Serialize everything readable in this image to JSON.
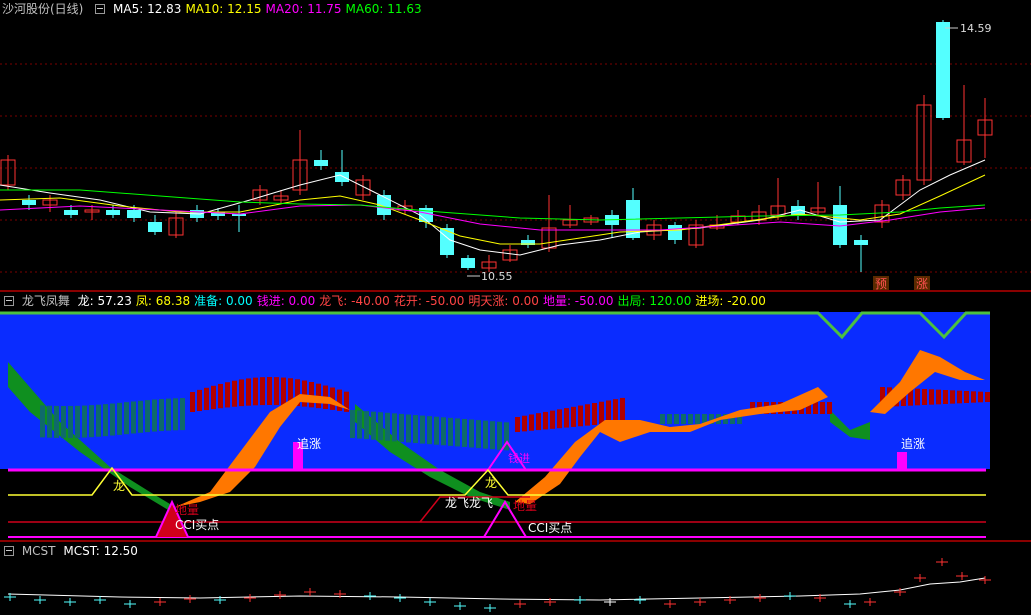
{
  "main": {
    "stock": "沙河股份(日线)",
    "ma": [
      {
        "label": "MA5: ",
        "value": "12.83",
        "color": "#ffffff"
      },
      {
        "label": "MA10: ",
        "value": "12.15",
        "color": "#ffff00"
      },
      {
        "label": "MA20: ",
        "value": "11.75",
        "color": "#ff00ff"
      },
      {
        "label": "MA60: ",
        "value": "11.63",
        "color": "#00ff00"
      }
    ],
    "high_label": "14.59",
    "low_label": "10.55",
    "tag_yu": "预",
    "tag_zhang": "涨",
    "colors": {
      "up": "#ff3232",
      "down": "#54ffff"
    }
  },
  "indicator": {
    "name": "龙飞凤舞",
    "items": [
      {
        "label": "龙: ",
        "value": "57.23",
        "color": "#ffffff"
      },
      {
        "label": "凤: ",
        "value": "68.38",
        "color": "#ffff00"
      },
      {
        "label": "准备: ",
        "value": "0.00",
        "color": "#00ffff"
      },
      {
        "label": "钱进: ",
        "value": "0.00",
        "color": "#ff00ff"
      },
      {
        "label": "龙飞: ",
        "value": "-40.00",
        "color": "#ff4444"
      },
      {
        "label": "花开: ",
        "value": "-50.00",
        "color": "#ff4444"
      },
      {
        "label": "明天涨: ",
        "value": "0.00",
        "color": "#ff4444"
      },
      {
        "label": "地量: ",
        "value": "-50.00",
        "color": "#ff00ff"
      },
      {
        "label": "出局: ",
        "value": "120.00",
        "color": "#00ff00"
      },
      {
        "label": "进场: ",
        "value": "-20.00",
        "color": "#ffff00"
      }
    ],
    "labels": {
      "zhuizhang": "追涨",
      "qianjin": "钱进",
      "long": "龙",
      "longfei": "龙飞龙飞",
      "cci": "CCI买点",
      "diliang": "地量",
      "feng": "凤"
    },
    "colors": {
      "bg": "#0a2cff",
      "green": "#0f8f1f",
      "orange": "#ff7700",
      "red": "#b00000",
      "teal": "#0f6a6a",
      "magenta": "#ff00ff",
      "yellow": "#ffff33",
      "crimson": "#d0001a"
    }
  },
  "mcst": {
    "name": "MCST",
    "label": "MCST: ",
    "value": "12.50"
  }
}
